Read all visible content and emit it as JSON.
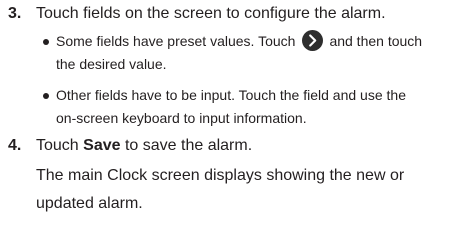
{
  "steps": [
    {
      "number": "3.",
      "text": "Touch fields on the screen to configure the alarm.",
      "bullets": [
        {
          "before_icon": "Some fields have preset values. Touch",
          "icon": "chevron-right-circle-icon",
          "after_icon": "and then touch",
          "line2": "the desired value."
        },
        {
          "line1": "Other fields have to be input. Touch the field and use the",
          "line2": "on-screen keyboard to input information."
        }
      ]
    },
    {
      "number": "4.",
      "text_before": "Touch",
      "text_bold": "Save",
      "text_after": "to save the alarm.",
      "para_line1": "The main Clock screen displays showing the new or",
      "para_line2": "updated alarm."
    }
  ],
  "colors": {
    "text": "#231f20",
    "icon_bg": "#2e2e2e",
    "icon_fg": "#ffffff"
  }
}
